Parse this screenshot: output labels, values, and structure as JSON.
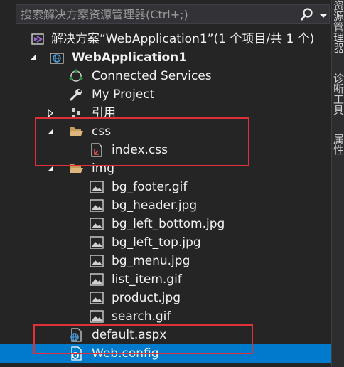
{
  "search": {
    "placeholder": "搜索解决方案资源管理器(Ctrl+;)"
  },
  "solution": {
    "label": "解决方案“WebApplication1”(1 个项目/共 1 个)"
  },
  "project": {
    "label": "WebApplication1"
  },
  "tree": {
    "connected_services": "Connected Services",
    "my_project": "My Project",
    "references": "引用",
    "css_folder": "css",
    "index_css": "index.css",
    "img_folder": "img",
    "images": [
      "bg_footer.gif",
      "bg_header.jpg",
      "bg_left_bottom.jpg",
      "bg_left_top.jpg",
      "bg_menu.jpg",
      "list_item.gif",
      "product.jpg",
      "search.gif"
    ],
    "default_aspx": "default.aspx",
    "web_config": "Web.config"
  },
  "right_tabs": [
    "资源管理器",
    "诊断工具",
    "属性"
  ],
  "colors": {
    "background": "#252526",
    "selection": "#007acc",
    "highlight_box": "#e0303a",
    "folder": "#dcb67a",
    "vs_purple": "#9b6bd3"
  }
}
